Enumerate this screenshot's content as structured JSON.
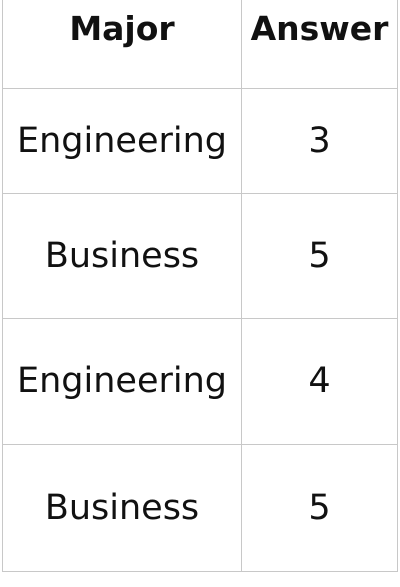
{
  "table": {
    "headers": [
      "Major",
      "Answer"
    ],
    "rows": [
      [
        "Engineering",
        "3"
      ],
      [
        "Business",
        "5"
      ],
      [
        "Engineering",
        "4"
      ],
      [
        "Business",
        "5"
      ]
    ]
  }
}
